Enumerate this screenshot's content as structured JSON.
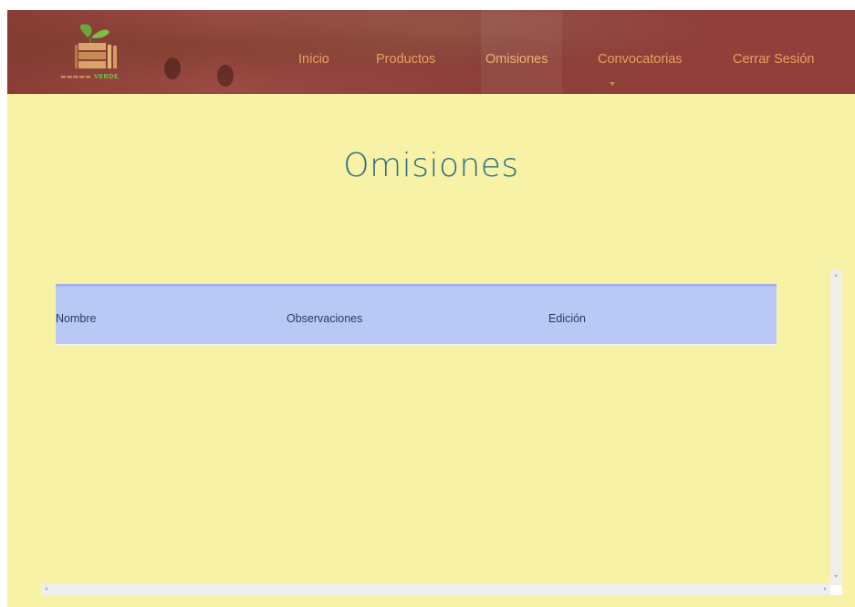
{
  "brand": {
    "logo_text": "VERDE"
  },
  "nav": {
    "items": [
      {
        "label": "Inicio"
      },
      {
        "label": "Productos"
      },
      {
        "label": "Omisiones"
      },
      {
        "label": "Convocatorias"
      },
      {
        "label": "Cerrar Sesión"
      }
    ],
    "active": "Omisiones"
  },
  "page": {
    "title": "Omisiones"
  },
  "table": {
    "columns": [
      "Nombre",
      "Observaciones",
      "Edición"
    ],
    "rows": []
  },
  "colors": {
    "background": "#f8f2a6",
    "header": "#8e3f3a",
    "nav_text": "#e9a05d",
    "title": "#2a6f80",
    "table_header": "#b9c8f5"
  },
  "icons": {
    "logo": "crate-with-leaves-logo",
    "scroll_up": "chevron-up-icon",
    "scroll_down": "chevron-down-icon",
    "scroll_left": "chevron-left-icon",
    "scroll_right": "chevron-right-icon"
  }
}
